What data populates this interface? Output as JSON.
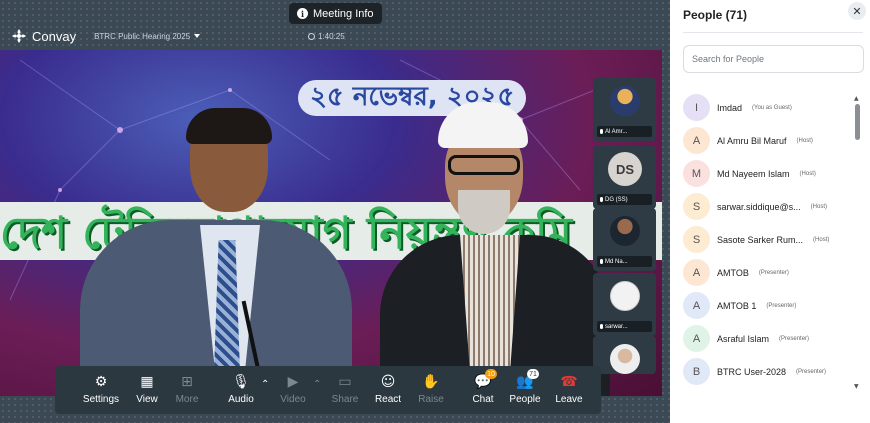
{
  "meeting_info": {
    "label": "Meeting Info"
  },
  "topbar": {
    "brand": "Convay",
    "event_name": "BTRC Public Hearing 2025",
    "elapsed": "1:40:25"
  },
  "stage": {
    "banner_date": "২৫ নভেম্বর, ২০২৫",
    "banner_text": "দেশ টেলিযোগাযোগ নিয়ন্ত্রণ কমি"
  },
  "tiles": [
    {
      "label": "Al Amr...",
      "kind": "photo"
    },
    {
      "label": "DG (SS)",
      "initials": "DS",
      "kind": "initials"
    },
    {
      "label": "Md Na...",
      "kind": "photo"
    },
    {
      "label": "sarwar...",
      "kind": "photo"
    },
    {
      "label": "",
      "kind": "photo"
    }
  ],
  "controls": {
    "settings": "Settings",
    "view": "View",
    "more": "More",
    "audio": "Audio",
    "video": "Video",
    "share": "Share",
    "react": "React",
    "raise": "Raise",
    "chat": "Chat",
    "chat_badge": "10",
    "people": "People",
    "people_badge": "71",
    "leave": "Leave"
  },
  "people_panel": {
    "title": "People (71)",
    "search_placeholder": "Search for People",
    "people": [
      {
        "initial": "I",
        "name": "Imdad",
        "role": "(You as Guest)",
        "color": "#e6e0f7"
      },
      {
        "initial": "A",
        "name": "Al Amru Bil Maruf",
        "role": "(Host)",
        "color": "#fde7d3"
      },
      {
        "initial": "M",
        "name": "Md Nayeem Islam",
        "role": "(Host)",
        "color": "#fbe0e0"
      },
      {
        "initial": "S",
        "name": "sarwar.siddique@s...",
        "role": "(Host)",
        "color": "#fdebd2"
      },
      {
        "initial": "S",
        "name": "Sasote Sarker Rum...",
        "role": "(Host)",
        "color": "#fdebd2"
      },
      {
        "initial": "A",
        "name": "AMTOB",
        "role": "(Presenter)",
        "color": "#fde7d3"
      },
      {
        "initial": "A",
        "name": "AMTOB 1",
        "role": "(Presenter)",
        "color": "#e1e8f8"
      },
      {
        "initial": "A",
        "name": "Asraful Islam",
        "role": "(Presenter)",
        "color": "#dff3e6"
      },
      {
        "initial": "B",
        "name": "BTRC User-2028",
        "role": "(Presenter)",
        "color": "#e1e8f8"
      }
    ]
  }
}
